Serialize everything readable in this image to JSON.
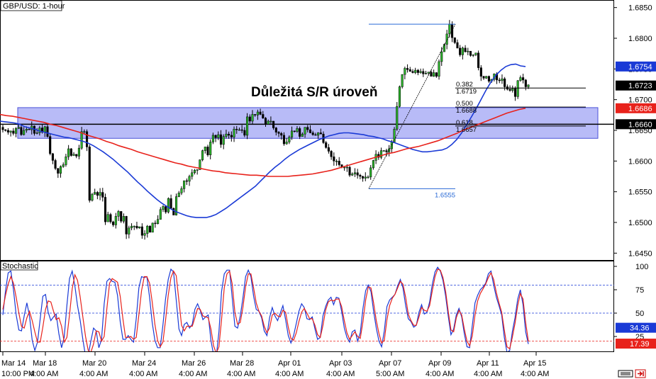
{
  "chart_data": [
    {
      "type": "candlestick",
      "title": "GBP/USD: 1-hour",
      "annotation": "Důležitá S/R úroveň",
      "ylim": [
        1.644,
        1.686
      ],
      "y_ticks": [
        "1.6850",
        "1.6800",
        "1.6750",
        "1.6700",
        "1.6650",
        "1.6600",
        "1.6550",
        "1.6500",
        "1.6450"
      ],
      "price_tags": [
        {
          "value": "1.6754",
          "color": "#1a3ad6"
        },
        {
          "value": "1.6723",
          "color": "#000000"
        },
        {
          "value": "1.6686",
          "color": "#e8221b"
        },
        {
          "value": "1.6660",
          "color": "#000000"
        }
      ],
      "sr_zone": {
        "low": 1.6637,
        "high": 1.6687,
        "level": 1.666
      },
      "fib": {
        "high": 1.6823,
        "low": 1.6555,
        "low_label": "1.6555",
        "levels": [
          {
            "ratio": "0.382",
            "price": "1.6719"
          },
          {
            "ratio": "0.500",
            "price": "1.6688"
          },
          {
            "ratio": "0.618",
            "price": "1.6657"
          }
        ]
      },
      "series": [
        {
          "name": "",
          "values": [
            1.6651,
            1.665,
            1.6647,
            1.6649,
            1.6645,
            1.6653,
            1.6655,
            1.6643,
            1.665,
            1.6652,
            1.6651,
            1.6657,
            1.6645,
            1.6646,
            1.6654,
            1.6647,
            1.6656,
            1.664,
            1.6612,
            1.6601,
            1.6588,
            1.658,
            1.6591,
            1.6594,
            1.6607,
            1.662,
            1.6609,
            1.6611,
            1.6608,
            1.6621,
            1.6648,
            1.6648,
            1.6623,
            1.6536,
            1.6546,
            1.6549,
            1.6544,
            1.6549,
            1.6541,
            1.6501,
            1.6513,
            1.6501,
            1.6496,
            1.651,
            1.6518,
            1.6502,
            1.651,
            1.6481,
            1.6491,
            1.6494,
            1.6494,
            1.6491,
            1.6493,
            1.6479,
            1.6482,
            1.6494,
            1.6484,
            1.6499,
            1.6498,
            1.6505,
            1.6521,
            1.6526,
            1.6517,
            1.6539,
            1.6523,
            1.6512,
            1.6542,
            1.6548,
            1.6555,
            1.6568,
            1.6567,
            1.6575,
            1.6581,
            1.6585,
            1.6586,
            1.6602,
            1.6617,
            1.6623,
            1.661,
            1.6631,
            1.6642,
            1.6638,
            1.6643,
            1.6627,
            1.664,
            1.6644,
            1.6642,
            1.6639,
            1.6652,
            1.6651,
            1.6651,
            1.665,
            1.6642,
            1.6672,
            1.6665,
            1.6676,
            1.6675,
            1.668,
            1.6676,
            1.667,
            1.666,
            1.6665,
            1.6665,
            1.6654,
            1.6647,
            1.6645,
            1.6642,
            1.6628,
            1.6631,
            1.6639,
            1.6649,
            1.6648,
            1.6653,
            1.664,
            1.6644,
            1.6655,
            1.6651,
            1.6646,
            1.6643,
            1.6642,
            1.6646,
            1.6644,
            1.663,
            1.6622,
            1.6616,
            1.6607,
            1.66,
            1.66,
            1.6594,
            1.659,
            1.659,
            1.659,
            1.6577,
            1.6579,
            1.6581,
            1.6577,
            1.6575,
            1.6572,
            1.6574,
            1.6574,
            1.6589,
            1.6601,
            1.6611,
            1.6606,
            1.6617,
            1.6617,
            1.6615,
            1.662,
            1.6631,
            1.6652,
            1.6689,
            1.6721,
            1.6741,
            1.6751,
            1.6749,
            1.6746,
            1.6744,
            1.6748,
            1.6744,
            1.6746,
            1.6742,
            1.6743,
            1.6745,
            1.6738,
            1.6744,
            1.6738,
            1.6762,
            1.6778,
            1.679,
            1.6807,
            1.6823,
            1.6801,
            1.6793,
            1.6784,
            1.6773,
            1.6784,
            1.6778,
            1.6779,
            1.6772,
            1.6773,
            1.6776,
            1.6752,
            1.6738,
            1.6735,
            1.6738,
            1.673,
            1.6733,
            1.6742,
            1.6732,
            1.6731,
            1.6734,
            1.6721,
            1.6717,
            1.6715,
            1.6718,
            1.6705,
            1.6731,
            1.6736,
            1.6732,
            1.6721,
            1.6724
          ]
        },
        {
          "name": "",
          "values": [
            1.6665,
            1.6664,
            1.6663,
            1.6662,
            1.666,
            1.6656,
            1.6654,
            1.6652,
            1.6649,
            1.6647,
            1.6645,
            1.6643,
            1.6641,
            1.6639,
            1.6638,
            1.6636,
            1.6634,
            1.6632,
            1.6629,
            1.6625,
            1.662,
            1.6615,
            1.6609,
            1.6603,
            1.6596,
            1.6589,
            1.6582,
            1.6574,
            1.6566,
            1.6559,
            1.6551,
            1.6544,
            1.6537,
            1.6531,
            1.6526,
            1.6521,
            1.6517,
            1.6514,
            1.6511,
            1.6509,
            1.6508,
            1.6508,
            1.6508,
            1.651,
            1.6513,
            1.6518,
            1.6523,
            1.6529,
            1.6535,
            1.6541,
            1.6547,
            1.6553,
            1.6559,
            1.6567,
            1.6575,
            1.6583,
            1.659,
            1.6596,
            1.6603,
            1.6609,
            1.6614,
            1.6619,
            1.6623,
            1.6627,
            1.6631,
            1.6635,
            1.6638,
            1.6641,
            1.6643,
            1.6645,
            1.6646,
            1.6646,
            1.6645,
            1.6644,
            1.6643,
            1.6641,
            1.664,
            1.6638,
            1.6636,
            1.6633,
            1.6631,
            1.6628,
            1.6625,
            1.6622,
            1.6619,
            1.6617,
            1.6615,
            1.6615,
            1.6616,
            1.6617,
            1.6618,
            1.6621,
            1.6627,
            1.6635,
            1.6646,
            1.6659,
            1.6672,
            1.6686,
            1.6701,
            1.6716,
            1.6729,
            1.674,
            1.6748,
            1.6754,
            1.6757,
            1.6758,
            1.6755,
            1.6754
          ]
        },
        {
          "name": "",
          "values": [
            1.6676,
            1.6674,
            1.6673,
            1.6671,
            1.6669,
            1.6667,
            1.6665,
            1.6663,
            1.666,
            1.6658,
            1.6655,
            1.6652,
            1.6649,
            1.6646,
            1.6642,
            1.6639,
            1.6636,
            1.6632,
            1.6629,
            1.6625,
            1.6622,
            1.6619,
            1.6615,
            1.6612,
            1.6609,
            1.6606,
            1.6603,
            1.66,
            1.6597,
            1.6595,
            1.6592,
            1.659,
            1.6588,
            1.6586,
            1.6584,
            1.6583,
            1.6581,
            1.658,
            1.6579,
            1.6578,
            1.6577,
            1.6577,
            1.6576,
            1.6575,
            1.6575,
            1.6575,
            1.6575,
            1.6576,
            1.6577,
            1.6578,
            1.6579,
            1.6581,
            1.6583,
            1.6585,
            1.6588,
            1.6591,
            1.6594,
            1.6597,
            1.66,
            1.6603,
            1.6606,
            1.6609,
            1.6612,
            1.6614,
            1.6617,
            1.662,
            1.6622,
            1.6624,
            1.6627,
            1.663,
            1.6633,
            1.6637,
            1.6641,
            1.6645,
            1.665,
            1.6654,
            1.6658,
            1.6662,
            1.6666,
            1.667,
            1.6674,
            1.6678,
            1.6681,
            1.6684,
            1.6686
          ]
        }
      ]
    },
    {
      "type": "line",
      "title": "Stochastic",
      "ylim": [
        0,
        100
      ],
      "y_ticks": [
        "100",
        "75",
        "50",
        "25"
      ],
      "levels": [
        80,
        50,
        20
      ],
      "value_tags": [
        {
          "value": "34.36",
          "color": "#1a3ad6"
        },
        {
          "value": "17.39",
          "color": "#e8221b"
        }
      ],
      "x_ticks": [
        {
          "top": "Mar 14",
          "bottom": "10:00 PM"
        },
        {
          "top": "Mar 18",
          "bottom": "4:00 AM"
        },
        {
          "top": "Mar 20",
          "bottom": "4:00 AM"
        },
        {
          "top": "Mar 24",
          "bottom": "4:00 AM"
        },
        {
          "top": "Mar 26",
          "bottom": "4:00 AM"
        },
        {
          "top": "Mar 28",
          "bottom": "4:00 AM"
        },
        {
          "top": "Apr 01",
          "bottom": "4:00 AM"
        },
        {
          "top": "Apr 03",
          "bottom": "4:00 AM"
        },
        {
          "top": "Apr 07",
          "bottom": "5:00 AM"
        },
        {
          "top": "Apr 09",
          "bottom": "4:00 AM"
        },
        {
          "top": "Apr 11",
          "bottom": "4:00 AM"
        },
        {
          "top": "Apr 15",
          "bottom": "4:00 AM"
        }
      ],
      "series": [
        {
          "name": "",
          "values": [
            48,
            74,
            93,
            95,
            75,
            48,
            32,
            31,
            47,
            61,
            47,
            21,
            10,
            19,
            44,
            68,
            70,
            51,
            42,
            46,
            49,
            28,
            13,
            24,
            58,
            87,
            95,
            79,
            58,
            42,
            22,
            4,
            5,
            20,
            34,
            31,
            13,
            22,
            60,
            84,
            87,
            84,
            83,
            69,
            41,
            22,
            22,
            26,
            22,
            19,
            44,
            77,
            89,
            88,
            89,
            67,
            40,
            21,
            13,
            13,
            37,
            65,
            86,
            97,
            94,
            64,
            33,
            26,
            38,
            40,
            34,
            38,
            54,
            60,
            53,
            43,
            46,
            48,
            21,
            5,
            3,
            30,
            73,
            92,
            96,
            96,
            66,
            36,
            34,
            47,
            66,
            89,
            96,
            89,
            68,
            54,
            52,
            45,
            31,
            26,
            45,
            56,
            47,
            42,
            50,
            58,
            43,
            26,
            18,
            26,
            39,
            52,
            60,
            56,
            44,
            43,
            46,
            33,
            22,
            24,
            47,
            57,
            64,
            67,
            59,
            67,
            66,
            52,
            34,
            24,
            19,
            30,
            32,
            20,
            29,
            55,
            74,
            80,
            73,
            52,
            34,
            20,
            14,
            31,
            57,
            64,
            67,
            70,
            79,
            86,
            77,
            58,
            44,
            41,
            35,
            37,
            51,
            59,
            49,
            51,
            62,
            81,
            94,
            99,
            95,
            85,
            68,
            46,
            27,
            33,
            48,
            55,
            46,
            28,
            14,
            13,
            37,
            61,
            69,
            75,
            78,
            82,
            92,
            95,
            80,
            67,
            58,
            48,
            24,
            8,
            10,
            30,
            45,
            65,
            75,
            59,
            30,
            17
          ]
        },
        {
          "name": "",
          "values": [
            54,
            69,
            81,
            89,
            82,
            67,
            50,
            36,
            34,
            45,
            52,
            42,
            30,
            19,
            19,
            35,
            54,
            63,
            62,
            52,
            43,
            45,
            36,
            19,
            24,
            48,
            76,
            91,
            85,
            67,
            46,
            25,
            10,
            8,
            17,
            31,
            30,
            20,
            25,
            55,
            82,
            87,
            85,
            83,
            68,
            44,
            24,
            24,
            25,
            22,
            24,
            48,
            74,
            89,
            89,
            82,
            62,
            38,
            21,
            14,
            19,
            42,
            69,
            88,
            95,
            90,
            63,
            37,
            31,
            36,
            36,
            36,
            45,
            55,
            54,
            47,
            46,
            45,
            33,
            15,
            7,
            14,
            43,
            77,
            92,
            95,
            81,
            51,
            38,
            40,
            56,
            78,
            92,
            92,
            77,
            61,
            52,
            47,
            36,
            29,
            34,
            48,
            50,
            47,
            46,
            53,
            51,
            35,
            23,
            21,
            29,
            41,
            51,
            55,
            50,
            44,
            44,
            37,
            27,
            24,
            37,
            53,
            62,
            64,
            63,
            65,
            65,
            57,
            42,
            29,
            22,
            26,
            30,
            25,
            23,
            41,
            64,
            78,
            77,
            61,
            42,
            28,
            18,
            21,
            43,
            58,
            66,
            70,
            77,
            84,
            81,
            67,
            49,
            42,
            37,
            37,
            46,
            56,
            53,
            52,
            58,
            74,
            89,
            97,
            96,
            88,
            73,
            51,
            32,
            30,
            45,
            53,
            48,
            33,
            20,
            15,
            26,
            48,
            63,
            71,
            76,
            81,
            88,
            93,
            86,
            72,
            61,
            51,
            32,
            14,
            12,
            24,
            39,
            58,
            71,
            65,
            40,
            20
          ]
        }
      ]
    }
  ]
}
